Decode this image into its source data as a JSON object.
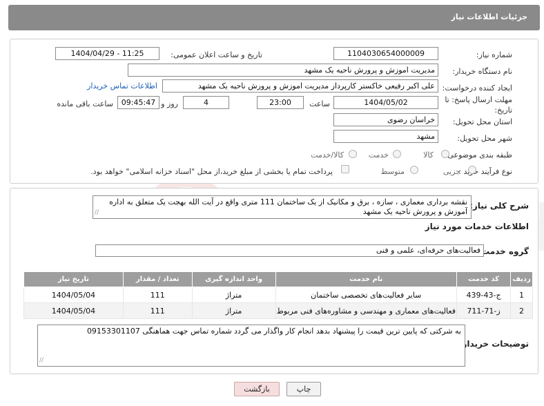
{
  "header": {
    "title": "جزئیات اطلاعات نیاز"
  },
  "form": {
    "need_number_label": "شماره نیاز:",
    "need_number": "1104030654000009",
    "announce_label": "تاریخ و ساعت اعلان عمومی:",
    "announce_value": "1404/04/29 - 11:25",
    "buyer_org_label": "نام دستگاه خریدار:",
    "buyer_org": "مدیریت اموزش و پرورش ناحیه یک مشهد",
    "creator_label": "ایجاد کننده درخواست:",
    "creator": "علی اکبر رفیعی خاکستر کارپرداز مدیریت اموزش و پرورش ناحیه یک مشهد",
    "contact_link": "اطلاعات تماس خریدار",
    "deadline_label": "مهلت ارسال پاسخ: تا تاریخ:",
    "deadline_date": "1404/05/02",
    "time_label": "ساعت",
    "deadline_time": "23:00",
    "days_value": "4",
    "days_label": "روز و",
    "remaining_time": "09:45:47",
    "remaining_label": "ساعت باقی مانده",
    "province_label": "استان محل تحویل:",
    "province": "خراسان رضوی",
    "city_label": "شهر محل تحویل:",
    "city": "مشهد",
    "category_label": "طبقه بندی موضوعی:",
    "category_options": [
      "کالا",
      "خدمت",
      "کالا/خدمت"
    ],
    "process_label": "نوع فرآیند خرید :",
    "process_options": [
      "جزیی",
      "متوسط"
    ],
    "payment_note": "پرداخت تمام یا بخشی از مبلغ خرید،از محل \"اسناد خزانه اسلامی\" خواهد بود."
  },
  "details": {
    "summary_label": "شرح کلی نیاز:",
    "summary": "نقشه برداری معماری ، سازه ، برق و مکانیک از یک ساختمان 111 متری واقع در آیت الله بهجت یک متعلق به اداره آموزش و پرورش ناحیه یک مشهد",
    "services_title": "اطلاعات خدمات مورد نیاز",
    "service_group_label": "گروه خدمت:",
    "service_group": "فعالیت‌های حرفه‌ای، علمی و فنی",
    "table": {
      "headers": [
        "ردیف",
        "کد خدمت",
        "نام خدمت",
        "واحد اندازه گیری",
        "تعداد / مقدار",
        "تاریخ نیاز"
      ],
      "rows": [
        [
          "1",
          "ج-43-439",
          "سایر فعالیت‌های تخصصی ساختمان",
          "متراژ",
          "111",
          "1404/05/04"
        ],
        [
          "2",
          "ز-71-711",
          "فعالیت‌های معماری و مهندسی و مشاوره‌های فنی مربوط",
          "متراژ",
          "111",
          "1404/05/04"
        ]
      ]
    },
    "buyer_notes_label": "توضیحات خریدار:",
    "buyer_notes": "به شرکتی که پایین ترین قیمت را پیشنهاد بدهد انجام کار واگذار می گردد شماره تماس جهت هماهنگی 09153301107"
  },
  "buttons": {
    "print": "چاپ",
    "back": "بازگشت"
  }
}
